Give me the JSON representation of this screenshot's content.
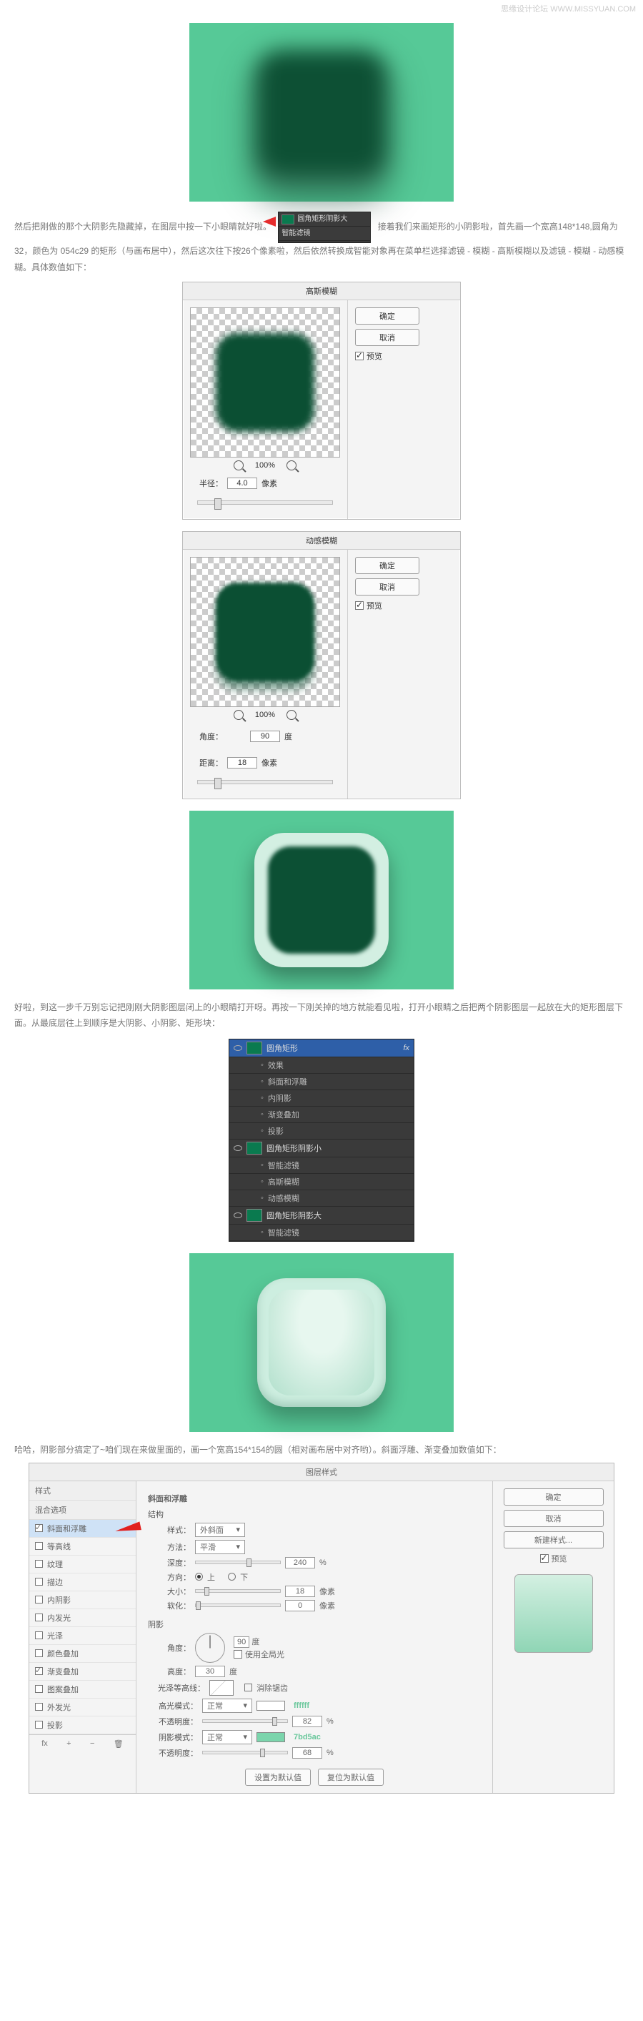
{
  "watermark": "思缘设计论坛   WWW.MISSYUAN.COM",
  "inline_panel": {
    "row1": "圆角矩形阴影大",
    "row2": "智能滤镜"
  },
  "para1_a": "然后把刚做的那个大阴影先隐藏掉，在图层中按一下小眼睛就好啦。",
  "para1_b": "接着我们来画矩形的小阴影啦，首先画一个宽高148*148,圆角为32，颜色为 054c29 的矩形（与画布居中），然后这次往下按26个像素啦，然后依然转换成智能对象再在菜单栏选择滤镜 - 模糊 - 高斯模糊以及滤镜 - 模糊 - 动感模糊。具体数值如下：",
  "gauss": {
    "title": "高斯模糊",
    "ok": "确定",
    "cancel": "取消",
    "preview": "预览",
    "zoom": "100%",
    "radius_label": "半径：",
    "radius_val": "4.0",
    "unit": "像素"
  },
  "motion": {
    "title": "动感模糊",
    "ok": "确定",
    "cancel": "取消",
    "preview": "预览",
    "zoom": "100%",
    "angle_label": "角度：",
    "angle_val": "90",
    "angle_unit": "度",
    "dist_label": "距离：",
    "dist_val": "18",
    "dist_unit": "像素"
  },
  "para2": "好啦，到这一步千万别忘记把刚刚大阴影图层闭上的小眼睛打开呀。再按一下刚关掉的地方就能看见啦，打开小眼睛之后把两个阴影图层一起放在大的矩形图层下面。从最底层往上到顺序是大阴影、小阴影、矩形块：",
  "layers": {
    "r1": "圆角矩形",
    "r1_fx": "fx",
    "r1_sub": [
      "效果",
      "斜面和浮雕",
      "内阴影",
      "渐变叠加",
      "投影"
    ],
    "r2": "圆角矩形阴影小",
    "r2_sub": [
      "智能滤镜",
      "高斯模糊",
      "动感模糊"
    ],
    "r3": "圆角矩形阴影大",
    "r3_sub": [
      "智能滤镜"
    ]
  },
  "para3": "哈哈，阴影部分搞定了~咱们现在来做里面的，画一个宽高154*154的圆（相对画布居中对齐哟）。斜面浮雕、渐变叠加数值如下：",
  "ls": {
    "title": "图层样式",
    "left_hd1": "样式",
    "left_hd2": "混合选项",
    "opts": [
      "斜面和浮雕",
      "等高线",
      "纹理",
      "描边",
      "内阴影",
      "内发光",
      "光泽",
      "颜色叠加",
      "渐变叠加",
      "图案叠加",
      "外发光",
      "投影"
    ],
    "checked": {
      "斜面和浮雕": true,
      "渐变叠加": true
    },
    "sel": "斜面和浮雕",
    "footer": [
      "fx",
      "+",
      "−",
      "🗑"
    ],
    "mid_head": "斜面和浮雕",
    "sec1": "结构",
    "style_l": "样式：",
    "style_v": "外斜面",
    "tech_l": "方法：",
    "tech_v": "平滑",
    "depth_l": "深度：",
    "depth_v": "240",
    "pct": "%",
    "dir_l": "方向：",
    "dir_up": "上",
    "dir_dn": "下",
    "size_l": "大小：",
    "size_v": "18",
    "px": "像素",
    "soft_l": "软化：",
    "soft_v": "0",
    "sec2": "阴影",
    "angle_l": "角度：",
    "angle_v": "90",
    "deg": "度",
    "global": "使用全局光",
    "alt_l": "高度：",
    "alt_v": "30",
    "gloss_l": "光泽等高线：",
    "anti": "消除锯齿",
    "hi_mode_l": "高光模式：",
    "hi_mode_v": "正常",
    "hi_hex": "ffffff",
    "hi_op_l": "不透明度：",
    "hi_op_v": "82",
    "sh_mode_l": "阴影模式：",
    "sh_mode_v": "正常",
    "sh_hex": "7bd5ac",
    "sh_op_l": "不透明度：",
    "sh_op_v": "68",
    "btn_def": "设置为默认值",
    "btn_reset": "复位为默认值",
    "ok": "确定",
    "cancel": "取消",
    "newstyle": "新建样式...",
    "preview": "预览"
  }
}
